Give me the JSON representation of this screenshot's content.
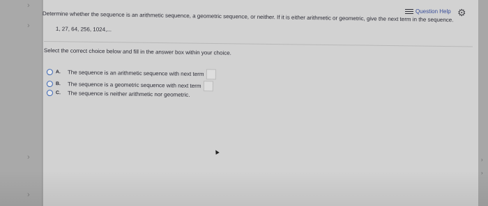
{
  "toolbar": {
    "help_label": "Question Help",
    "help_icon": "list-icon",
    "settings_icon": "gear-icon"
  },
  "question": {
    "prompt": "Determine whether the sequence is an arithmetic sequence, a geometric sequence, or neither. If it is either arithmetic or geometric, give the next term in the sequence.",
    "sequence": "1, 27, 64, 256, 1024,...",
    "instruction": "Select the correct choice below and fill in the answer box within your choice."
  },
  "choices": [
    {
      "letter": "A.",
      "text": "The sequence is an arithmetic sequence with next term"
    },
    {
      "letter": "B.",
      "text": "The sequence is a geometric sequence with next term"
    },
    {
      "letter": "C.",
      "text": "The sequence is neither arithmetic nor geometric."
    }
  ],
  "colors": {
    "accent": "#3b66b6",
    "panel": "#d2d2d2",
    "text": "#2c2c36"
  }
}
